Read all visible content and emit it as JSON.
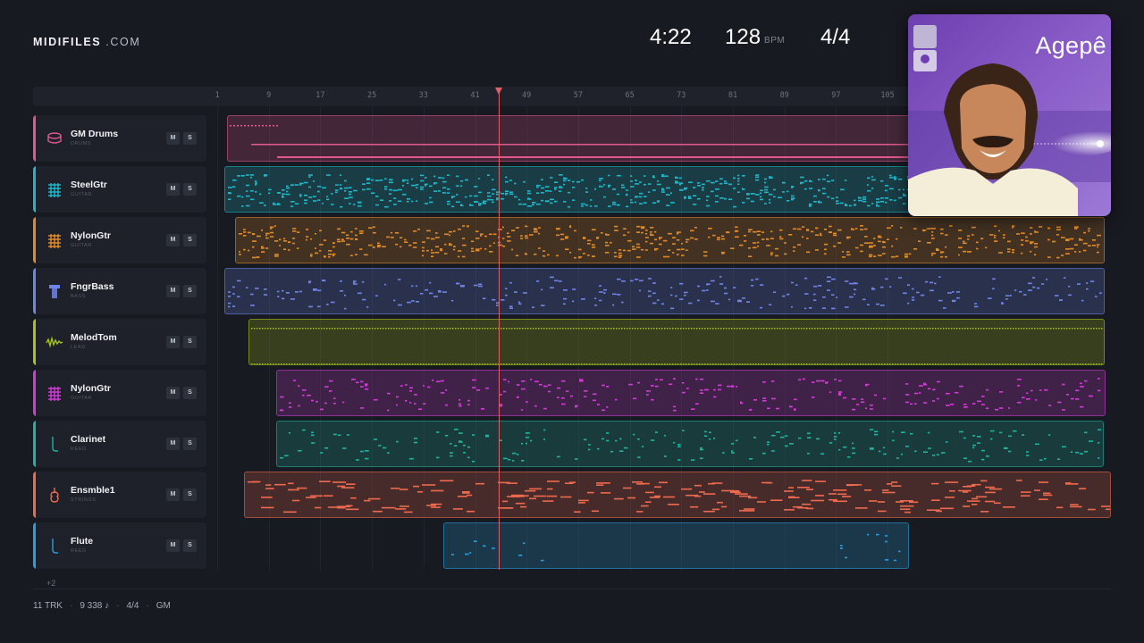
{
  "brand": {
    "name": "MIDIFILES",
    "suffix": ".COM"
  },
  "stats": {
    "duration": "4:22",
    "bpm": "128",
    "bpm_unit": "BPM",
    "time_signature": "4/4"
  },
  "ruler": {
    "ticks": [
      "1",
      "9",
      "17",
      "25",
      "33",
      "41",
      "49",
      "57",
      "65",
      "73",
      "81",
      "89",
      "97",
      "105"
    ]
  },
  "tracks": [
    {
      "name": "GM Drums",
      "category": "DRUMS",
      "color": "#e0588e",
      "icon": "drum-icon"
    },
    {
      "name": "SteelGtr",
      "category": "GUITAR",
      "color": "#1fb7c9",
      "icon": "guitar-grid-icon"
    },
    {
      "name": "NylonGtr",
      "category": "GUITAR",
      "color": "#e08a2a",
      "icon": "guitar-grid-icon"
    },
    {
      "name": "FngrBass",
      "category": "BASS",
      "color": "#6f84e8",
      "icon": "bass-icon"
    },
    {
      "name": "MelodTom",
      "category": "LEAD",
      "color": "#a8c21a",
      "icon": "waveform-icon"
    },
    {
      "name": "NylonGtr",
      "category": "GUITAR",
      "color": "#d23bd8",
      "icon": "guitar-grid-icon"
    },
    {
      "name": "Clarinet",
      "category": "REED",
      "color": "#1fb3a0",
      "icon": "reed-icon"
    },
    {
      "name": "Ensmble1",
      "category": "STRINGS",
      "color": "#ee6a4e",
      "icon": "violin-icon"
    },
    {
      "name": "Flute",
      "category": "REED",
      "color": "#2a9fe0",
      "icon": "reed-icon"
    }
  ],
  "buttons": {
    "mute": "M",
    "solo": "S"
  },
  "more_tracks": "+2",
  "footer": {
    "tracks": "11 TRK",
    "notes": "9 338 ♪",
    "time_signature": "4/4",
    "standard": "GM"
  },
  "album": {
    "artist": "Agepê"
  }
}
